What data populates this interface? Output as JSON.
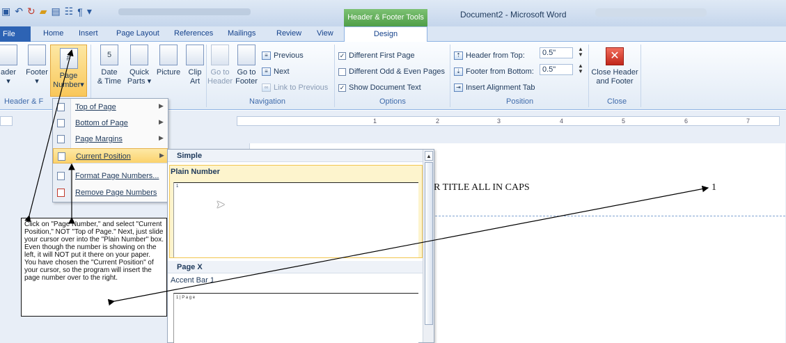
{
  "titlebar": {
    "context_tab": "Header & Footer Tools",
    "document_title": "Document2 - Microsoft Word"
  },
  "tabs": [
    "File",
    "Home",
    "Insert",
    "Page Layout",
    "References",
    "Mailings",
    "Review",
    "View",
    "Design"
  ],
  "ribbon": {
    "header_footer_group": {
      "header_label": "ader",
      "footer_label": "Footer",
      "page_number_line1": "Page",
      "page_number_line2": "Number",
      "label": "Header & F"
    },
    "insert_group": {
      "date_line1": "Date",
      "date_line2": "& Time",
      "quick_line1": "Quick",
      "quick_line2": "Parts",
      "picture": "Picture",
      "clip_line1": "Clip",
      "clip_line2": "Art"
    },
    "navigation_group": {
      "goto_header_line1": "Go to",
      "goto_header_line2": "Header",
      "goto_footer_line1": "Go to",
      "goto_footer_line2": "Footer",
      "previous": "Previous",
      "next": "Next",
      "link_to_previous": "Link to Previous",
      "label": "Navigation"
    },
    "options_group": {
      "different_first_page": "Different First Page",
      "different_odd_even": "Different Odd & Even Pages",
      "show_document_text": "Show Document Text",
      "different_first_page_checked": true,
      "different_odd_even_checked": false,
      "show_document_text_checked": true,
      "label": "Options"
    },
    "position_group": {
      "header_from_top": "Header from Top:",
      "header_from_top_value": "0.5\"",
      "footer_from_bottom": "Footer from Bottom:",
      "footer_from_bottom_value": "0.5\"",
      "insert_alignment_tab": "Insert Alignment Tab",
      "label": "Position"
    },
    "close_group": {
      "close_line1": "Close Header",
      "close_line2": "and Footer",
      "label": "Close"
    }
  },
  "ruler_ticks": [
    "1",
    "2",
    "3",
    "4",
    "5",
    "6",
    "7"
  ],
  "menu": {
    "items": [
      {
        "label": "Top of Page",
        "submenu": true
      },
      {
        "label": "Bottom of Page",
        "submenu": true
      },
      {
        "label": "Page Margins",
        "submenu": true
      },
      {
        "label": "Current Position",
        "submenu": true
      },
      {
        "label": "Format Page Numbers...",
        "submenu": false
      },
      {
        "label": "Remove Page Numbers",
        "submenu": false
      }
    ],
    "highlighted": "Current Position"
  },
  "gallery": {
    "section_simple": "Simple",
    "plain_number": "Plain Number",
    "plain_number_preview": "1",
    "section_page_x": "Page X",
    "accent_bar": "Accent Bar 1",
    "accent_bar_preview": "1 | P a g e"
  },
  "document": {
    "title_text": "R TITLE ALL IN CAPS",
    "page_number": "1"
  },
  "callout": {
    "text": "Click on \"Page Number,\" and select \"Current Position,\" NOT \"Top of Page.\" Next, just slide your cursor over into the \"Plain Number\" box. Even though the number is showing on the left, it will NOT put it there on your paper. You have chosen the \"Current Position\" of your cursor, so the program will insert the page number over to the right."
  },
  "colors": {
    "context_tab": "#4f9e47",
    "file_tab": "#2d63b4",
    "highlight": "#fbd26c",
    "ribbon_text": "#1e395b"
  }
}
